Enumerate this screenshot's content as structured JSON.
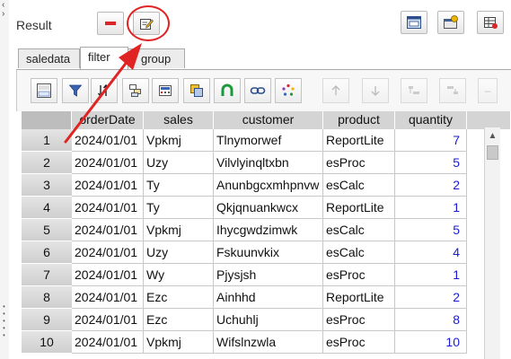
{
  "result_panel": {
    "title": "Result"
  },
  "tabs": [
    {
      "label": "saledata",
      "active": false
    },
    {
      "label": "filter",
      "active": true
    },
    {
      "label": "group",
      "active": false
    }
  ],
  "grid": {
    "columns": [
      "orderDate",
      "sales",
      "customer",
      "product",
      "quantity"
    ],
    "rows": [
      {
        "n": "1",
        "orderDate": "2024/01/01",
        "sales": "Vpkmj",
        "customer": "Tlnymorwef",
        "product": "ReportLite",
        "quantity": "7"
      },
      {
        "n": "2",
        "orderDate": "2024/01/01",
        "sales": "Uzy",
        "customer": "Vilvlyinqltxbn",
        "product": "esProc",
        "quantity": "5"
      },
      {
        "n": "3",
        "orderDate": "2024/01/01",
        "sales": "Ty",
        "customer": "Anunbgcxmhpnvw",
        "product": "esCalc",
        "quantity": "2"
      },
      {
        "n": "4",
        "orderDate": "2024/01/01",
        "sales": "Ty",
        "customer": "Qkjqnuankwcx",
        "product": "ReportLite",
        "quantity": "1"
      },
      {
        "n": "5",
        "orderDate": "2024/01/01",
        "sales": "Vpkmj",
        "customer": "Ihycgwdzimwk",
        "product": "esCalc",
        "quantity": "5"
      },
      {
        "n": "6",
        "orderDate": "2024/01/01",
        "sales": "Uzy",
        "customer": "Fskuunvkix",
        "product": "esCalc",
        "quantity": "4"
      },
      {
        "n": "7",
        "orderDate": "2024/01/01",
        "sales": "Wy",
        "customer": "Pjysjsh",
        "product": "esProc",
        "quantity": "1"
      },
      {
        "n": "8",
        "orderDate": "2024/01/01",
        "sales": "Ezc",
        "customer": "Ainhhd",
        "product": "ReportLite",
        "quantity": "2"
      },
      {
        "n": "9",
        "orderDate": "2024/01/01",
        "sales": "Ezc",
        "customer": "Uchuhlj",
        "product": "esProc",
        "quantity": "8"
      },
      {
        "n": "10",
        "orderDate": "2024/01/01",
        "sales": "Vpkmj",
        "customer": "Wifslnzwla",
        "product": "esProc",
        "quantity": "10"
      }
    ]
  },
  "icons": {
    "top_buttons": [
      "remove-icon",
      "edit-icon",
      "window-icon",
      "settings-window-icon",
      "grid-config-icon"
    ],
    "toolbar": [
      "abc-123-icon",
      "filter-icon",
      "sort-icon",
      "group-icon",
      "calculator-icon",
      "copy-icon",
      "magnet-icon",
      "link-icon",
      "spinner-icon",
      "arrow-up-icon",
      "arrow-down-icon",
      "indent-left-icon",
      "indent-right-icon",
      "more-icon"
    ]
  },
  "colors": {
    "annotation": "#e02424",
    "quantity_text": "#1a1ad6",
    "remove_button": "#d9262b"
  }
}
